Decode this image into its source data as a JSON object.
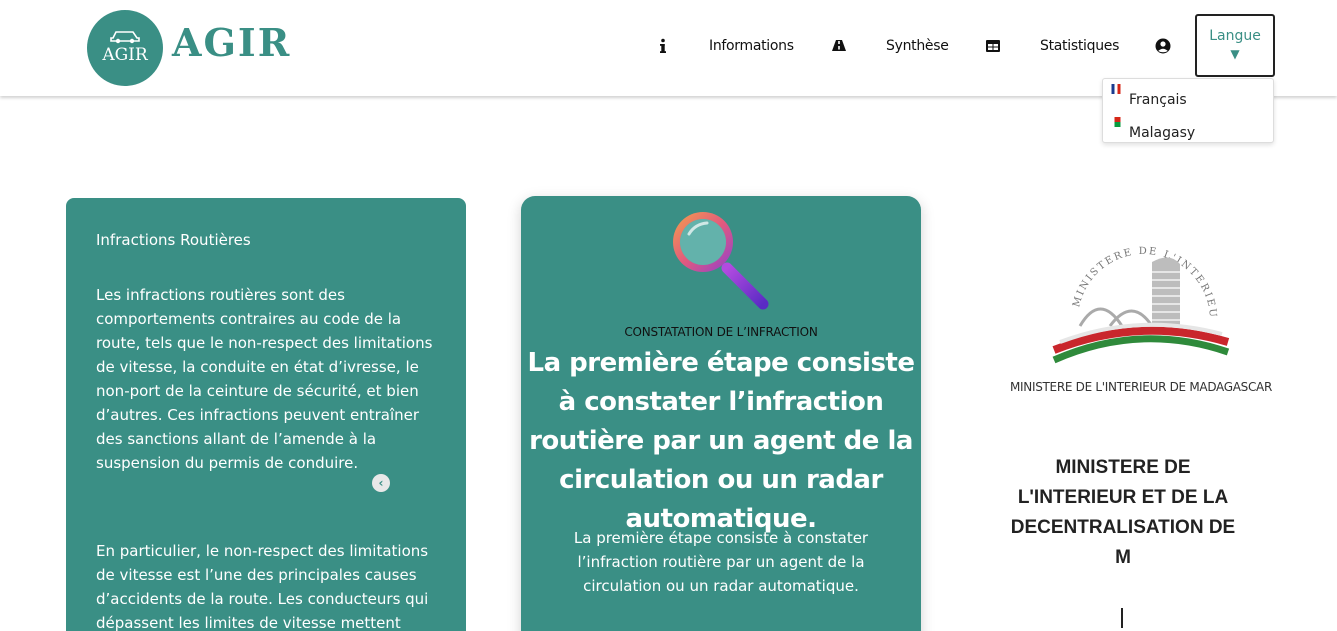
{
  "header": {
    "logo_badge_text": "AGIR",
    "logo_word": "AGIR",
    "nav": {
      "informations": "Informations",
      "synthese": "Synthèse",
      "statistiques": "Statistiques"
    },
    "language_button": {
      "label": "Langue",
      "arrow": "▼"
    },
    "language_menu": [
      {
        "label": "Français",
        "flag": "france-flag"
      },
      {
        "label": "Malagasy",
        "flag": "madagascar-flag"
      }
    ]
  },
  "card_infractions": {
    "title": "Infractions Routières",
    "paragraph_1": "Les infractions routières sont des comportements contraires au code de la route, tels que le non-respect des limitations de vitesse, la conduite en état d’ivresse, le non-port de la ceinture de sécurité, et bien d’autres. Ces infractions peuvent entraîner des sanctions allant de l’amende à la suspension du permis de conduire.",
    "paragraph_2": "En particulier, le non-respect des limitations de vitesse est l’une des principales causes d’accidents de la route. Les conducteurs qui dépassent les limites de vitesse mettent",
    "prev_icon": "chevron-left-circle-icon"
  },
  "card_constatation": {
    "caption": "CONSTATATION DE L’INFRACTION",
    "headline": "La première étape consiste à constater l’infraction routière par un agent de la circulation ou un radar automatique.",
    "body": "La première étape consiste à constater l’infraction routière par un agent de la circulation ou un radar automatique.",
    "icon": "magnifier-icon"
  },
  "ministry": {
    "seal_text": "MINISTERE DE L'INTERIEUR",
    "seal_caption": "MINISTERE DE L'INTERIEUR DE MADAGASCAR",
    "title": "MINISTERE DE L'INTERIEUR ET DE LA DECENTRALISATION DE M"
  },
  "colors": {
    "brand": "#3a8f85",
    "text_dark": "#222222"
  }
}
